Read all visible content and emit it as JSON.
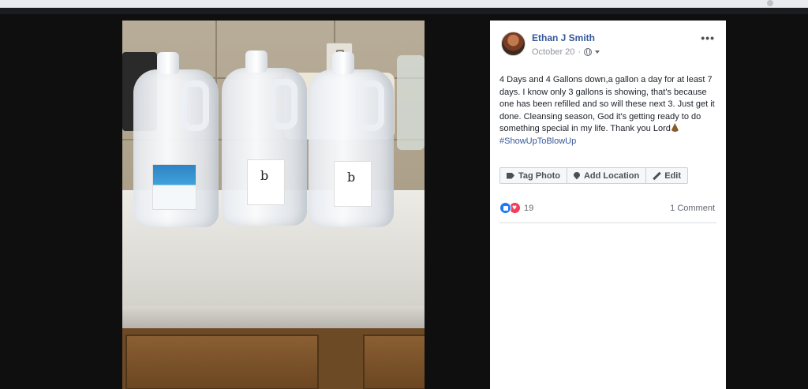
{
  "post": {
    "author": "Ethan J Smith",
    "date": "October 20",
    "more_label": "•••",
    "text_main": "4 Days and 4 Gallons down,a gallon a day for at least 7 days. I know only 3 gallons is showing, that's because one has been refilled and so will these next 3. Just get it done. Cleansing season, God it's getting ready to do something special in my life. Thank you Lord",
    "hashtag": "#ShowUpToBlowUp",
    "actions": {
      "tag_photo": "Tag Photo",
      "add_location": "Add Location",
      "edit": "Edit"
    },
    "reactions_count": "19",
    "comments_label": "1 Comment"
  },
  "photo": {
    "jug_label_brand": "b"
  },
  "colors": {
    "link": "#365899",
    "background": "#0f0f10",
    "like": "#2078f4",
    "love": "#f33e58"
  }
}
